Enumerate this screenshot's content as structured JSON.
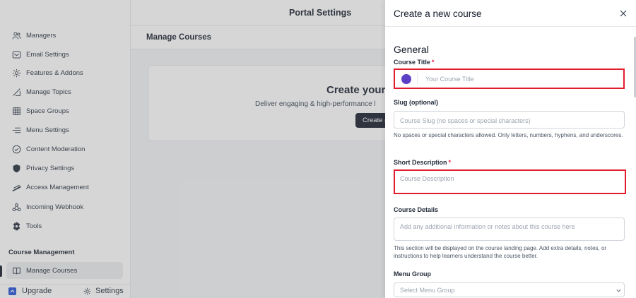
{
  "sidebar": {
    "items": [
      {
        "label": "Managers",
        "icon": "users-icon"
      },
      {
        "label": "Email Settings",
        "icon": "email-icon"
      },
      {
        "label": "Features & Addons",
        "icon": "gear-icon"
      },
      {
        "label": "Manage Topics",
        "icon": "tag-icon"
      },
      {
        "label": "Space Groups",
        "icon": "grid-icon"
      },
      {
        "label": "Menu Settings",
        "icon": "menu-icon"
      },
      {
        "label": "Content Moderation",
        "icon": "check-circle-icon"
      },
      {
        "label": "Privacy Settings",
        "icon": "shield-icon"
      },
      {
        "label": "Access Management",
        "icon": "key-icon"
      },
      {
        "label": "Incoming Webhook",
        "icon": "webhook-icon"
      },
      {
        "label": "Tools",
        "icon": "wrench-icon"
      }
    ],
    "section_title": "Course Management",
    "active_item": {
      "label": "Manage Courses",
      "icon": "course-icon"
    },
    "upgrade_label": "Upgrade",
    "settings_label": "Settings"
  },
  "header": {
    "title": "Portal Settings"
  },
  "main": {
    "title": "Manage Courses",
    "card": {
      "title": "Create your",
      "subtitle": "Deliver engaging & high-performance l",
      "button_label": "Create a"
    }
  },
  "drawer": {
    "title": "Create a new course",
    "section_title": "General",
    "course_title": {
      "label": "Course Title",
      "required": "*",
      "placeholder": "Your Course Title"
    },
    "slug": {
      "label": "Slug (optional)",
      "placeholder": "Course Slug (no spaces or special characters)",
      "help": "No spaces or special characters allowed. Only letters, numbers, hyphens, and underscores."
    },
    "short_description": {
      "label": "Short Description",
      "required": "*",
      "placeholder": "Course Description"
    },
    "course_details": {
      "label": "Course Details",
      "placeholder": "Add any additional information or notes about this course here",
      "help": "This section will be displayed on the course landing page. Add extra details, notes, or instructions to help learners understand the course better."
    },
    "menu_group": {
      "label": "Menu Group",
      "placeholder": "Select Menu Group"
    }
  },
  "colors": {
    "accent": "#111827",
    "highlight": "#e11d2d",
    "required": "#e11d48",
    "emoji_dot": "#5b3fc4",
    "upgrade_icon": "#1d4ed8"
  }
}
